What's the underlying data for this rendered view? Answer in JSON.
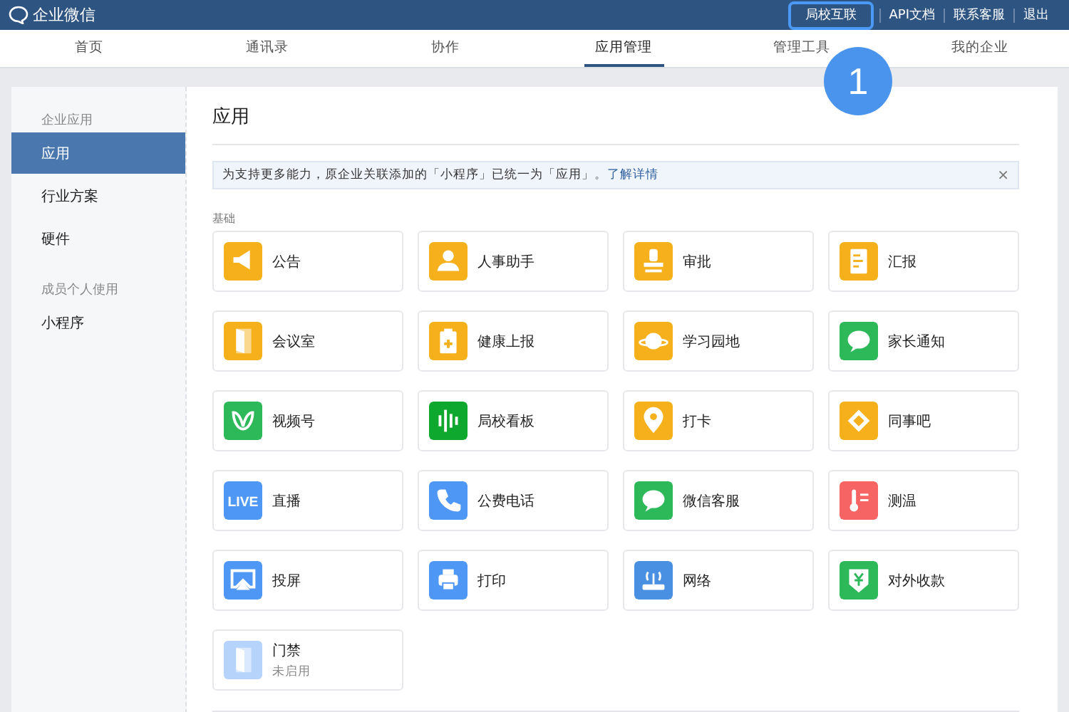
{
  "topbar": {
    "logo": "企业微信",
    "links": [
      {
        "label": "局校互联",
        "highlighted": true
      },
      {
        "label": "API文档",
        "highlighted": false
      },
      {
        "label": "联系客服",
        "highlighted": false
      },
      {
        "label": "退出",
        "highlighted": false
      }
    ]
  },
  "nav": [
    {
      "label": "首页",
      "selected": false
    },
    {
      "label": "通讯录",
      "selected": false
    },
    {
      "label": "协作",
      "selected": false
    },
    {
      "label": "应用管理",
      "selected": true
    },
    {
      "label": "管理工具",
      "selected": false
    },
    {
      "label": "我的企业",
      "selected": false
    }
  ],
  "annotation": {
    "label": "1"
  },
  "sidebar": [
    {
      "kind": "heading",
      "label": "企业应用"
    },
    {
      "kind": "item",
      "label": "应用",
      "selected": true
    },
    {
      "kind": "item",
      "label": "行业方案",
      "selected": false
    },
    {
      "kind": "item",
      "label": "硬件",
      "selected": false
    },
    {
      "kind": "heading",
      "label": "成员个人使用"
    },
    {
      "kind": "item",
      "label": "小程序",
      "selected": false
    }
  ],
  "main": {
    "title": "应用",
    "notice": {
      "text": "为支持更多能力，原企业关联添加的「小程序」已统一为「应用」。",
      "link": "了解详情",
      "close": "×"
    },
    "section": "基础",
    "apps": [
      {
        "name": "公告",
        "kind": "megaphone",
        "color": "#f5b01b",
        "enabled": true
      },
      {
        "name": "人事助手",
        "kind": "person",
        "color": "#f5b01b",
        "enabled": true
      },
      {
        "name": "审批",
        "kind": "stamp",
        "color": "#f5b01b",
        "enabled": true
      },
      {
        "name": "汇报",
        "kind": "report",
        "color": "#f5b01b",
        "enabled": true
      },
      {
        "name": "会议室",
        "kind": "door",
        "color": "#f5b01b",
        "enabled": true
      },
      {
        "name": "健康上报",
        "kind": "clipboard",
        "color": "#f5b01b",
        "enabled": true
      },
      {
        "name": "学习园地",
        "kind": "planet",
        "color": "#f5b01b",
        "enabled": true
      },
      {
        "name": "家长通知",
        "kind": "chat",
        "color": "#2db85a",
        "enabled": true
      },
      {
        "name": "视频号",
        "kind": "butterfly",
        "color": "#2db85a",
        "enabled": true
      },
      {
        "name": "局校看板",
        "kind": "bars",
        "color": "#0ea82f",
        "enabled": true
      },
      {
        "name": "打卡",
        "kind": "pin",
        "color": "#f5b01b",
        "enabled": true
      },
      {
        "name": "同事吧",
        "kind": "network",
        "color": "#f5b01b",
        "enabled": true
      },
      {
        "name": "直播",
        "kind": "text",
        "icon_text": "LIVE",
        "color": "#4f97f5",
        "enabled": true
      },
      {
        "name": "公费电话",
        "kind": "phone",
        "color": "#4f97f5",
        "enabled": true
      },
      {
        "name": "微信客服",
        "kind": "chat",
        "color": "#2db85a",
        "enabled": true
      },
      {
        "name": "测温",
        "kind": "thermometer",
        "color": "#f76464",
        "enabled": true
      },
      {
        "name": "投屏",
        "kind": "screen",
        "color": "#4f97f5",
        "enabled": true
      },
      {
        "name": "打印",
        "kind": "printer",
        "color": "#4f97f5",
        "enabled": true
      },
      {
        "name": "网络",
        "kind": "router",
        "color": "#4a90e2",
        "enabled": true
      },
      {
        "name": "对外收款",
        "kind": "shield",
        "color": "#2db85a",
        "enabled": true
      },
      {
        "name": "门禁",
        "kind": "door",
        "color": "#b5d3fb",
        "enabled": false,
        "status": "未启用"
      }
    ]
  }
}
